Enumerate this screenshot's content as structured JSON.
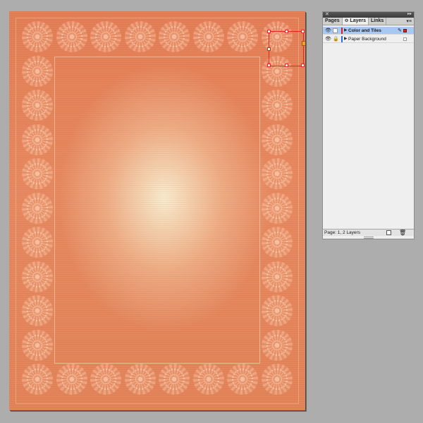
{
  "panel": {
    "close_glyph": "✕",
    "collapse_glyph": "▸▸",
    "menu_glyph": "▾≡",
    "tabs": [
      {
        "label": "Pages"
      },
      {
        "label": "≎ Layers"
      },
      {
        "label": "Links"
      }
    ],
    "layers": [
      {
        "name": "Color and Tiles",
        "visible_glyph": "👁",
        "arrow": "▶",
        "pen": "✎",
        "selected": true,
        "color": "#d9221b"
      },
      {
        "name": "Paper Background",
        "visible_glyph": "👁",
        "lock_glyph": "🔒",
        "arrow": "▶",
        "selected": false,
        "color": "#2f6ed8"
      }
    ],
    "status": "Page: 1, 2 Layers",
    "trash_glyph": "🗑"
  },
  "colors": {
    "page_background": "#adadad",
    "paper": "#e88a61",
    "selection": "#e2271d",
    "layer_highlight": "#a8c8f4"
  }
}
